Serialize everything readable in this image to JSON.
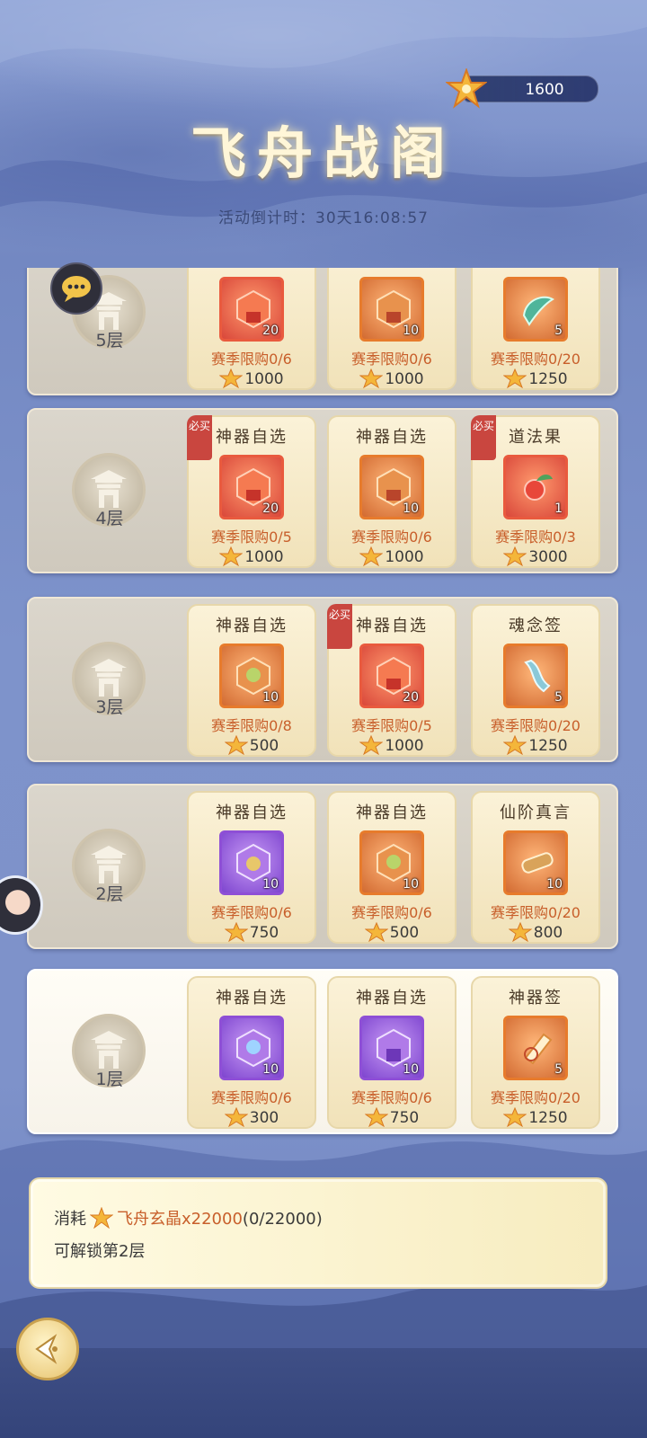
{
  "header": {
    "title": "飞舟战阁",
    "countdown": "活动倒计时：30天16:08:57",
    "currency_value": "1600"
  },
  "floors": [
    {
      "label": "5层",
      "cards": [
        {
          "name": "",
          "quantity": "20",
          "limit": "赛季限购0/6",
          "price": "1000",
          "quality": "red"
        },
        {
          "name": "",
          "quantity": "10",
          "limit": "赛季限购0/6",
          "price": "1000",
          "quality": "orange"
        },
        {
          "name": "",
          "quantity": "5",
          "limit": "赛季限购0/20",
          "price": "1250",
          "quality": "orange"
        }
      ]
    },
    {
      "label": "4层",
      "cards": [
        {
          "name": "神器自选",
          "badge": "必买",
          "quantity": "20",
          "limit": "赛季限购0/5",
          "price": "1000",
          "quality": "red"
        },
        {
          "name": "神器自选",
          "quantity": "10",
          "limit": "赛季限购0/6",
          "price": "1000",
          "quality": "orange"
        },
        {
          "name": "道法果",
          "badge": "必买",
          "quantity": "1",
          "limit": "赛季限购0/3",
          "price": "3000",
          "quality": "red"
        }
      ]
    },
    {
      "label": "3层",
      "cards": [
        {
          "name": "神器自选",
          "quantity": "10",
          "limit": "赛季限购0/8",
          "price": "500",
          "quality": "orange"
        },
        {
          "name": "神器自选",
          "badge": "必买",
          "quantity": "20",
          "limit": "赛季限购0/5",
          "price": "1000",
          "quality": "red"
        },
        {
          "name": "魂念签",
          "quantity": "5",
          "limit": "赛季限购0/20",
          "price": "1250",
          "quality": "orange"
        }
      ]
    },
    {
      "label": "2层",
      "cards": [
        {
          "name": "神器自选",
          "quantity": "10",
          "limit": "赛季限购0/6",
          "price": "750",
          "quality": "purple"
        },
        {
          "name": "神器自选",
          "quantity": "10",
          "limit": "赛季限购0/6",
          "price": "500",
          "quality": "orange"
        },
        {
          "name": "仙阶真言",
          "quantity": "10",
          "limit": "赛季限购0/20",
          "price": "800",
          "quality": "orange"
        }
      ]
    },
    {
      "label": "1层",
      "cards": [
        {
          "name": "神器自选",
          "quantity": "10",
          "limit": "赛季限购0/6",
          "price": "300",
          "quality": "purple"
        },
        {
          "name": "神器自选",
          "quantity": "10",
          "limit": "赛季限购0/6",
          "price": "750",
          "quality": "purple"
        },
        {
          "name": "神器签",
          "quantity": "5",
          "limit": "赛季限购0/20",
          "price": "1250",
          "quality": "orange"
        }
      ]
    }
  ],
  "unlock_panel": {
    "prefix": "消耗",
    "material": "飞舟玄晶x22000",
    "progress": "(0/22000)",
    "line2": "可解锁第2层"
  },
  "colors": {
    "accent_orange": "#c85f2b",
    "badge_red": "#c9463f",
    "background_blue": "#7f93c7"
  },
  "icons": {
    "currency": "maple-star-icon",
    "back": "back-arrow-icon",
    "chat": "chat-bubble-icon"
  }
}
